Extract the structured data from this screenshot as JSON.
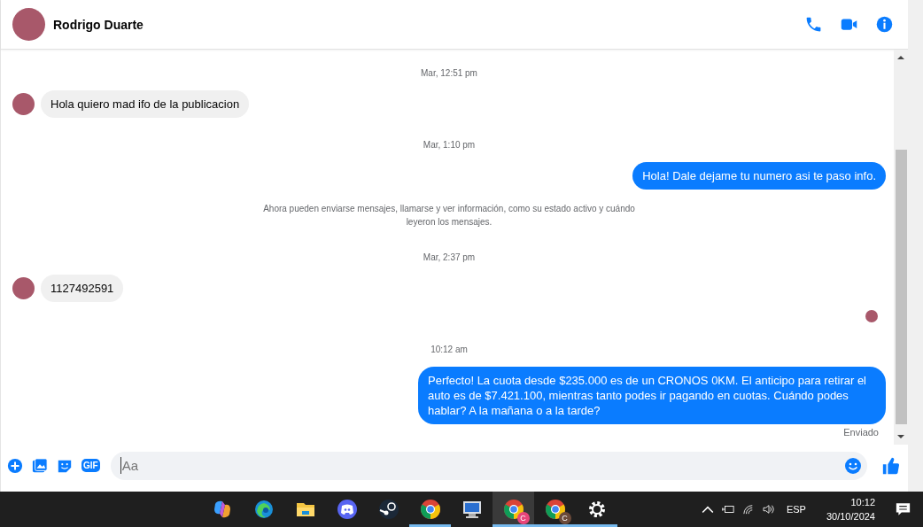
{
  "header": {
    "name": "Rodrigo Duarte"
  },
  "messages": [
    {
      "kind": "timestamp",
      "text": "Mar, 12:51 pm"
    },
    {
      "kind": "incoming",
      "text": "Hola quiero mad ifo de la publicacion"
    },
    {
      "kind": "timestamp",
      "text": "Mar, 1:10 pm"
    },
    {
      "kind": "outgoing",
      "text": "Hola! Dale dejame tu numero  asi te paso info."
    },
    {
      "kind": "notice",
      "text": "Ahora pueden enviarse mensajes, llamarse y ver información, como su estado activo y cuándo leyeron los mensajes."
    },
    {
      "kind": "timestamp",
      "text": "Mar, 2:37 pm"
    },
    {
      "kind": "incoming",
      "text": "1127492591"
    },
    {
      "kind": "seen"
    },
    {
      "kind": "timestamp",
      "text": "10:12 am"
    },
    {
      "kind": "outgoing",
      "text": "Perfecto! La cuota desde $235.000 es de un CRONOS 0KM. El anticipo para retirar el auto es de $7.421.100, mientras tanto podes ir pagando en cuotas. Cuándo podes hablar? A la mañana o a la tarde?",
      "status": "Enviado"
    }
  ],
  "composer": {
    "gif_label": "GIF",
    "placeholder": "Aa"
  },
  "taskbar": {
    "apps": [
      {
        "kind": "copilot",
        "running": false,
        "selected": false
      },
      {
        "kind": "edge",
        "running": false,
        "selected": false
      },
      {
        "kind": "folder",
        "running": false,
        "selected": false
      },
      {
        "kind": "discord",
        "running": false,
        "selected": false
      },
      {
        "kind": "steam",
        "running": false,
        "selected": false
      },
      {
        "kind": "chrome",
        "running": true,
        "selected": false
      },
      {
        "kind": "monitor",
        "running": false,
        "selected": false
      },
      {
        "kind": "chrome",
        "badge": "C",
        "color": "#e8457a",
        "running": true,
        "selected": true
      },
      {
        "kind": "chrome",
        "badge": "C",
        "color": "#6b4a3a",
        "running": true,
        "selected": false
      },
      {
        "kind": "gear",
        "running": true,
        "selected": false
      }
    ],
    "language": "ESP",
    "time": "10:12",
    "date": "30/10/2024"
  }
}
